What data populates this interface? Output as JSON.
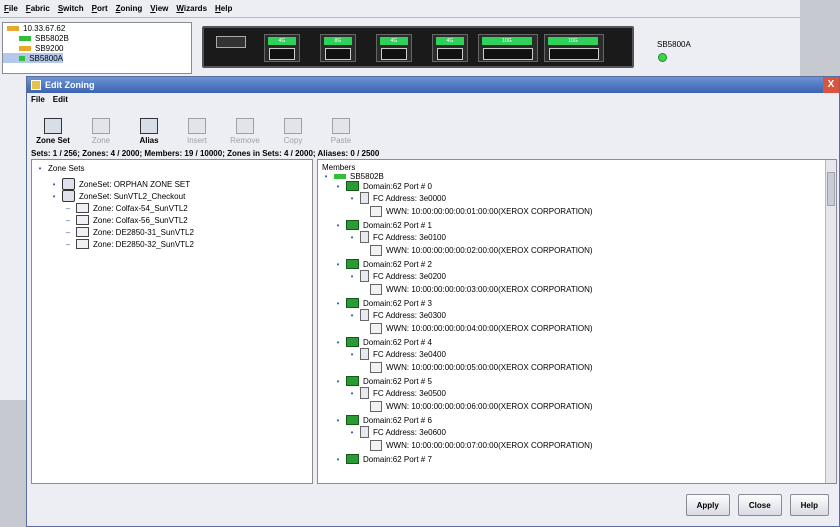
{
  "app": {
    "menu": [
      "File",
      "Fabric",
      "Switch",
      "Port",
      "Zoning",
      "View",
      "Wizards",
      "Help"
    ],
    "tree": [
      {
        "label": "10.33.67.62",
        "color": "#e7a82c"
      },
      {
        "label": "SB5802B",
        "color": "#2fbf3a"
      },
      {
        "label": "SB9200",
        "color": "#e7a82c"
      },
      {
        "label": "SB5800A",
        "color": "#2fbf3a"
      }
    ],
    "switch_label": "SB5800A",
    "sfp_labels": [
      "4G",
      "8G",
      "4G",
      "4G",
      "10G",
      "10G"
    ]
  },
  "dialog": {
    "title": "Edit Zoning",
    "close": "X",
    "menu": [
      "File",
      "Edit"
    ],
    "toolbar": [
      {
        "label": "Zone Set",
        "enabled": true,
        "icon": "zoneset-icon"
      },
      {
        "label": "Zone",
        "enabled": false,
        "icon": "zone-icon"
      },
      {
        "label": "Alias",
        "enabled": true,
        "icon": "alias-icon"
      },
      {
        "label": "Insert",
        "enabled": false,
        "icon": "insert-icon"
      },
      {
        "label": "Remove",
        "enabled": false,
        "icon": "remove-icon"
      },
      {
        "label": "Copy",
        "enabled": false,
        "icon": "copy-icon"
      },
      {
        "label": "Paste",
        "enabled": false,
        "icon": "paste-icon"
      }
    ],
    "stats": "Sets: 1 / 256;  Zones: 4 / 2000;  Members: 19 / 10000;  Zones in Sets: 4 / 2000;  Aliases: 0 / 2500",
    "left_tree": [
      {
        "label": "Zone Sets",
        "type": "root",
        "level": 0
      },
      {
        "label": "ZoneSet: ORPHAN ZONE SET",
        "type": "zoneset",
        "level": 1
      },
      {
        "label": "ZoneSet: SunVTL2_Checkout",
        "type": "zoneset",
        "level": 1
      },
      {
        "label": "Zone: Colfax-54_SunVTL2",
        "type": "zone",
        "level": 2
      },
      {
        "label": "Zone: Colfax-56_SunVTL2",
        "type": "zone",
        "level": 2
      },
      {
        "label": "Zone: DE2850-31_SunVTL2",
        "type": "zone",
        "level": 2
      },
      {
        "label": "Zone: DE2850-32_SunVTL2",
        "type": "zone",
        "level": 2
      }
    ],
    "members_header": "Members",
    "members_switch": "SB5802B",
    "members": [
      {
        "domain": "Domain:62 Port # 0",
        "fc": "FC Address: 3e0000",
        "wwn": "WWN: 10:00:00:00:00:01:00:00(XEROX CORPORATION)"
      },
      {
        "domain": "Domain:62 Port # 1",
        "fc": "FC Address: 3e0100",
        "wwn": "WWN: 10:00:00:00:00:02:00:00(XEROX CORPORATION)"
      },
      {
        "domain": "Domain:62 Port # 2",
        "fc": "FC Address: 3e0200",
        "wwn": "WWN: 10:00:00:00:00:03:00:00(XEROX CORPORATION)"
      },
      {
        "domain": "Domain:62 Port # 3",
        "fc": "FC Address: 3e0300",
        "wwn": "WWN: 10:00:00:00:00:04:00:00(XEROX CORPORATION)"
      },
      {
        "domain": "Domain:62 Port # 4",
        "fc": "FC Address: 3e0400",
        "wwn": "WWN: 10:00:00:00:00:05:00:00(XEROX CORPORATION)"
      },
      {
        "domain": "Domain:62 Port # 5",
        "fc": "FC Address: 3e0500",
        "wwn": "WWN: 10:00:00:00:00:06:00:00(XEROX CORPORATION)"
      },
      {
        "domain": "Domain:62 Port # 6",
        "fc": "FC Address: 3e0600",
        "wwn": "WWN: 10:00:00:00:00:07:00:00(XEROX CORPORATION)"
      },
      {
        "domain": "Domain:62 Port # 7",
        "fc": "",
        "wwn": ""
      }
    ],
    "buttons": [
      "Apply",
      "Close",
      "Help"
    ]
  }
}
